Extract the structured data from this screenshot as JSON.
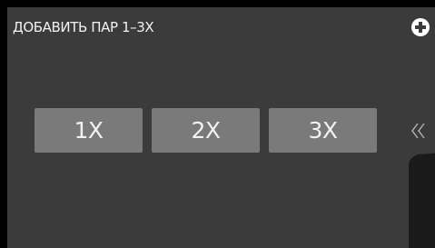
{
  "header": {
    "title": "ДОБАВИТЬ ПАР 1–3X",
    "add_icon": "plus-circle-icon"
  },
  "multipliers": [
    {
      "label": "1X"
    },
    {
      "label": "2X"
    },
    {
      "label": "3X"
    }
  ],
  "side_panel": {
    "collapse_icon": "double-chevron-left-icon"
  },
  "colors": {
    "background": "#000000",
    "panel": "#3b3b3b",
    "button": "#7a7a7a",
    "text": "#f2f2f2",
    "drawer": "#1a1a1a"
  }
}
